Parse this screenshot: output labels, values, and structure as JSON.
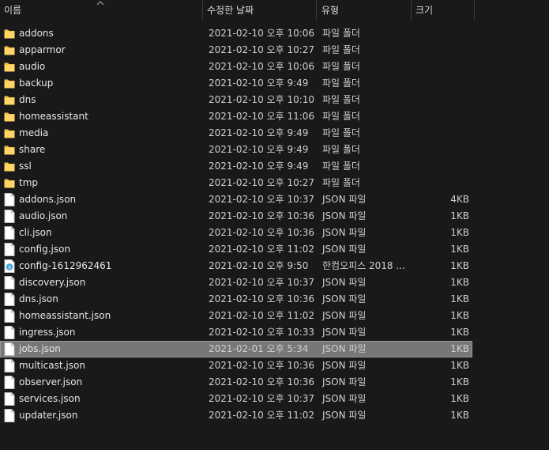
{
  "header": {
    "name_label": "이름",
    "date_label": "수정한 날짜",
    "type_label": "유형",
    "size_label": "크기"
  },
  "colors": {
    "background": "#191919",
    "folder": "#f2c34b",
    "selected_row": "#777777",
    "text": "#e6e6e6"
  },
  "files": [
    {
      "name": "addons",
      "date": "2021-02-10 오후 10:06",
      "type": "파일 폴더",
      "size": "",
      "icon": "folder-icon"
    },
    {
      "name": "apparmor",
      "date": "2021-02-10 오후 10:27",
      "type": "파일 폴더",
      "size": "",
      "icon": "folder-icon"
    },
    {
      "name": "audio",
      "date": "2021-02-10 오후 10:06",
      "type": "파일 폴더",
      "size": "",
      "icon": "folder-icon"
    },
    {
      "name": "backup",
      "date": "2021-02-10 오후 9:49",
      "type": "파일 폴더",
      "size": "",
      "icon": "folder-icon"
    },
    {
      "name": "dns",
      "date": "2021-02-10 오후 10:10",
      "type": "파일 폴더",
      "size": "",
      "icon": "folder-icon"
    },
    {
      "name": "homeassistant",
      "date": "2021-02-10 오후 11:06",
      "type": "파일 폴더",
      "size": "",
      "icon": "folder-icon"
    },
    {
      "name": "media",
      "date": "2021-02-10 오후 9:49",
      "type": "파일 폴더",
      "size": "",
      "icon": "folder-icon"
    },
    {
      "name": "share",
      "date": "2021-02-10 오후 9:49",
      "type": "파일 폴더",
      "size": "",
      "icon": "folder-icon"
    },
    {
      "name": "ssl",
      "date": "2021-02-10 오후 9:49",
      "type": "파일 폴더",
      "size": "",
      "icon": "folder-icon"
    },
    {
      "name": "tmp",
      "date": "2021-02-10 오후 10:27",
      "type": "파일 폴더",
      "size": "",
      "icon": "folder-icon"
    },
    {
      "name": "addons.json",
      "date": "2021-02-10 오후 10:37",
      "type": "JSON 파일",
      "size": "4KB",
      "icon": "file-icon"
    },
    {
      "name": "audio.json",
      "date": "2021-02-10 오후 10:36",
      "type": "JSON 파일",
      "size": "1KB",
      "icon": "file-icon"
    },
    {
      "name": "cli.json",
      "date": "2021-02-10 오후 10:36",
      "type": "JSON 파일",
      "size": "1KB",
      "icon": "file-icon"
    },
    {
      "name": "config.json",
      "date": "2021-02-10 오후 11:02",
      "type": "JSON 파일",
      "size": "1KB",
      "icon": "file-icon"
    },
    {
      "name": "config-1612962461",
      "date": "2021-02-10 오후 9:50",
      "type": "한컴오피스 2018 ...",
      "size": "1KB",
      "icon": "hancom-doc-icon"
    },
    {
      "name": "discovery.json",
      "date": "2021-02-10 오후 10:37",
      "type": "JSON 파일",
      "size": "1KB",
      "icon": "file-icon"
    },
    {
      "name": "dns.json",
      "date": "2021-02-10 오후 10:36",
      "type": "JSON 파일",
      "size": "1KB",
      "icon": "file-icon"
    },
    {
      "name": "homeassistant.json",
      "date": "2021-02-10 오후 11:02",
      "type": "JSON 파일",
      "size": "1KB",
      "icon": "file-icon"
    },
    {
      "name": "ingress.json",
      "date": "2021-02-10 오후 10:33",
      "type": "JSON 파일",
      "size": "1KB",
      "icon": "file-icon"
    },
    {
      "name": "jobs.json",
      "date": "2021-02-01 오후 5:34",
      "type": "JSON 파일",
      "size": "1KB",
      "icon": "file-icon",
      "selected": true
    },
    {
      "name": "multicast.json",
      "date": "2021-02-10 오후 10:36",
      "type": "JSON 파일",
      "size": "1KB",
      "icon": "file-icon"
    },
    {
      "name": "observer.json",
      "date": "2021-02-10 오후 10:36",
      "type": "JSON 파일",
      "size": "1KB",
      "icon": "file-icon"
    },
    {
      "name": "services.json",
      "date": "2021-02-10 오후 10:37",
      "type": "JSON 파일",
      "size": "1KB",
      "icon": "file-icon"
    },
    {
      "name": "updater.json",
      "date": "2021-02-10 오후 11:02",
      "type": "JSON 파일",
      "size": "1KB",
      "icon": "file-icon"
    }
  ]
}
